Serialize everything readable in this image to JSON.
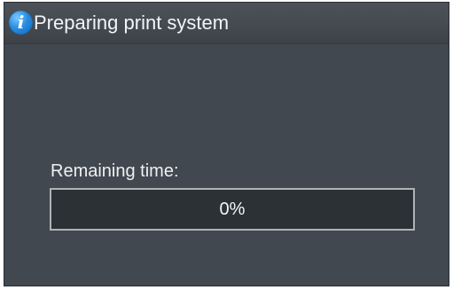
{
  "dialog": {
    "icon": "info-icon",
    "icon_glyph": "i",
    "title": "Preparing print system"
  },
  "progress": {
    "label": "Remaining time:",
    "value_text": "0%",
    "fraction": 0.0
  },
  "colors": {
    "background": "#414850",
    "titlebar": "#474c53",
    "info_icon": "#2a8de0",
    "progress_track": "#2c3136",
    "progress_border": "#aeb3b8",
    "text": "#f2f4f6"
  }
}
